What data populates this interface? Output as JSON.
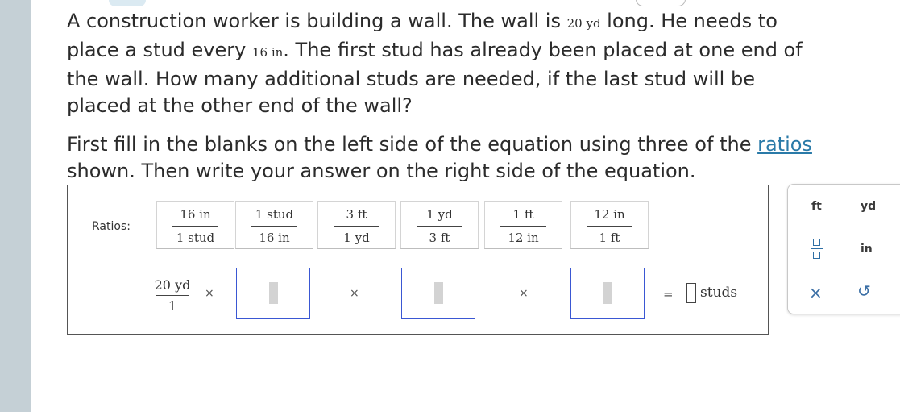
{
  "question": {
    "part1": "A construction worker is building a wall. The wall is ",
    "wall_length": "20 yd",
    "part2": " long. He needs to place a stud every ",
    "stud_spacing": "16 in",
    "part3": ". The first stud has already been placed at one end of the wall. How many additional studs are needed, if the last stud will be placed at the other end of the wall?",
    "inst1": "First fill in the blanks on the left side of the equation using three of the ",
    "ratios_link": "ratios",
    "inst2": " shown. Then write your answer on the right side of the equation."
  },
  "workspace": {
    "ratios_label": "Ratios:",
    "ratios": [
      {
        "num": "16 in",
        "den": "1 stud"
      },
      {
        "num": "1 stud",
        "den": "16 in"
      },
      {
        "num": "3 ft",
        "den": "1 yd"
      },
      {
        "num": "1 yd",
        "den": "3 ft"
      },
      {
        "num": "1 ft",
        "den": "12 in"
      },
      {
        "num": "12 in",
        "den": "1 ft"
      }
    ],
    "given": {
      "num": "20 yd",
      "den": "1"
    },
    "times": "×",
    "equals": "=",
    "answer_value": "",
    "answer_unit": "studs"
  },
  "palette": {
    "items": [
      "ft",
      "yd",
      "in"
    ],
    "clear": "×",
    "undo": "↺"
  },
  "colors": {
    "accent_blue": "#3a57d3",
    "link": "#2a7aa8",
    "side_strip": "#c5d0d6"
  }
}
